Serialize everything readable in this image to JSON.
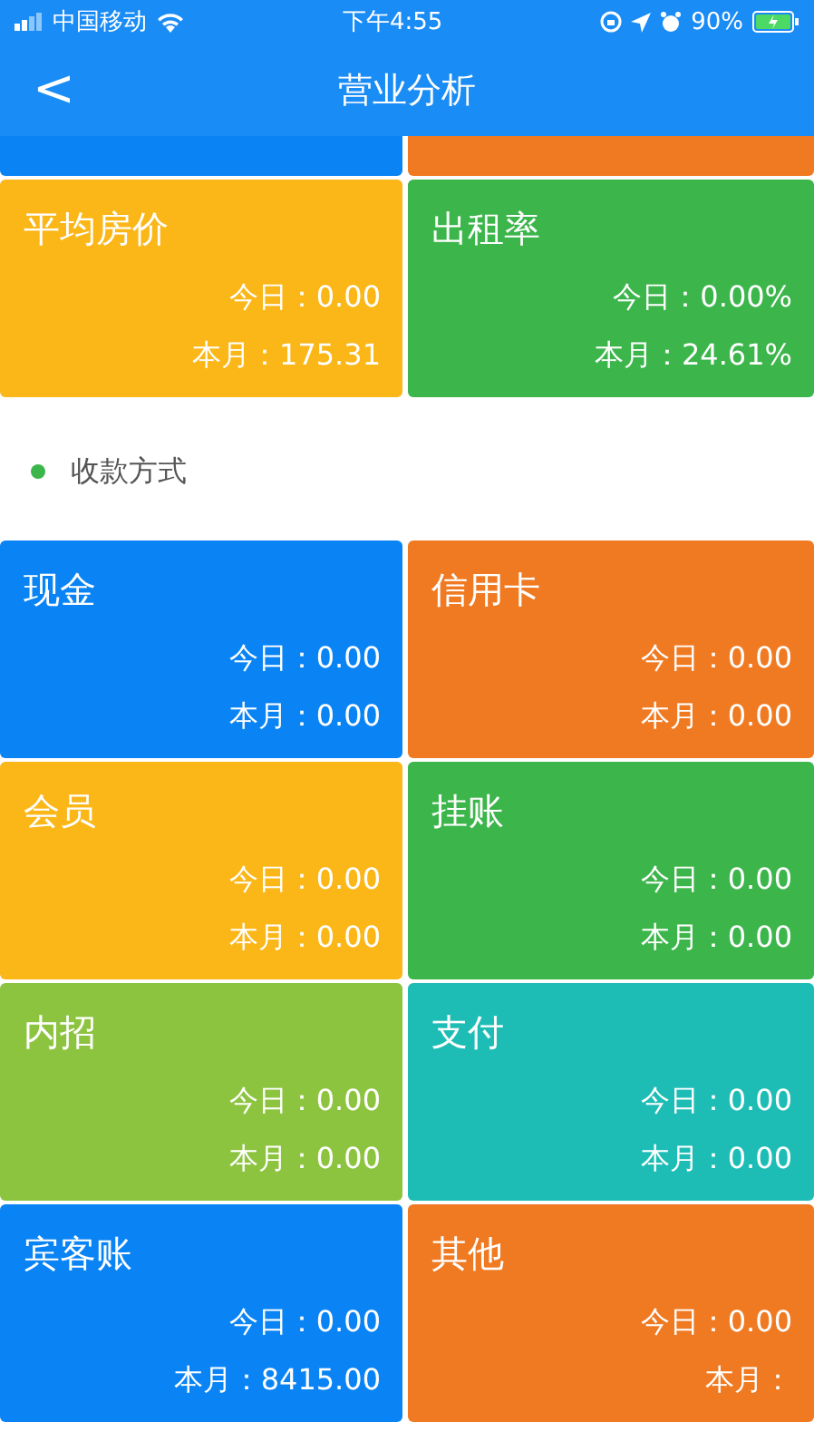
{
  "status_bar": {
    "carrier": "中国移动",
    "time": "下午4:55",
    "battery": "90%"
  },
  "header": {
    "title": "营业分析",
    "back": "<"
  },
  "covered_cards": [
    {
      "color": "#0a84f5"
    },
    {
      "color": "#f07a22"
    }
  ],
  "stats_cards": [
    {
      "title": "平均房价",
      "color": "#fbb617",
      "lines": [
        "今日：0.00",
        "本月：175.31"
      ]
    },
    {
      "title": "出租率",
      "color": "#3cb54b",
      "lines": [
        "今日：0.00%",
        "本月：24.61%"
      ]
    }
  ],
  "section": {
    "title": "收款方式",
    "color": "#3cb54b"
  },
  "payment_cards": [
    {
      "title": "现金",
      "color": "#0a84f5",
      "lines": [
        "今日：0.00",
        "本月：0.00"
      ]
    },
    {
      "title": "信用卡",
      "color": "#f07a22",
      "lines": [
        "今日：0.00",
        "本月：0.00"
      ]
    },
    {
      "title": "会员",
      "color": "#fbb617",
      "lines": [
        "今日：0.00",
        "本月：0.00"
      ]
    },
    {
      "title": "挂账",
      "color": "#3cb54b",
      "lines": [
        "今日：0.00",
        "本月：0.00"
      ]
    },
    {
      "title": "内招",
      "color": "#8cc43f",
      "lines": [
        "今日：0.00",
        "本月：0.00"
      ]
    },
    {
      "title": "支付",
      "color": "#1dbdb5",
      "lines": [
        "今日：0.00",
        "本月：0.00"
      ]
    },
    {
      "title": "宾客账",
      "color": "#0a84f5",
      "lines": [
        "今日：0.00",
        "本月：8415.00"
      ]
    },
    {
      "title": "其他",
      "color": "#f07a22",
      "lines": [
        "今日：0.00",
        "本月："
      ]
    }
  ]
}
